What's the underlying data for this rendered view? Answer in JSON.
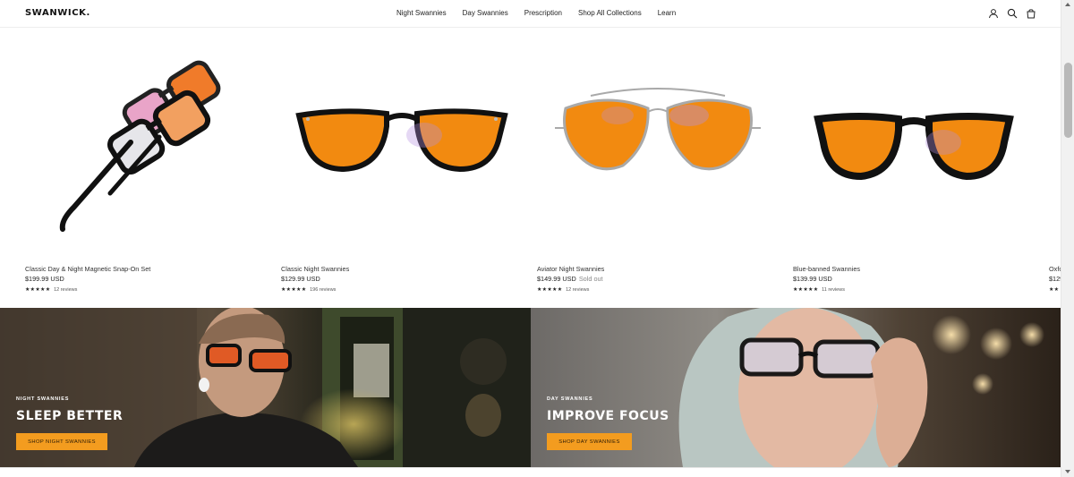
{
  "header": {
    "logo": "SWANWICK.",
    "nav": [
      "Night Swannies",
      "Day Swannies",
      "Prescription",
      "Shop All Collections",
      "Learn"
    ],
    "icons": [
      "account-icon",
      "search-icon",
      "cart-icon"
    ]
  },
  "products": [
    {
      "title": "Classic Day & Night Magnetic Snap-On Set",
      "price": "$199.99 USD",
      "status": "",
      "stars": "★★★★★",
      "reviews": "12 reviews"
    },
    {
      "title": "Classic Night Swannies",
      "price": "$129.99 USD",
      "status": "",
      "stars": "★★★★★",
      "reviews": "196 reviews"
    },
    {
      "title": "Aviator Night Swannies",
      "price": "$149.99 USD",
      "status": "Sold out",
      "stars": "★★★★★",
      "reviews": "12 reviews"
    },
    {
      "title": "Blue-banned Swannies",
      "price": "$139.99 USD",
      "status": "",
      "stars": "★★★★★",
      "reviews": "11 reviews"
    },
    {
      "title": "Oxfo",
      "price": "$129",
      "status": "",
      "stars": "★★",
      "reviews": ""
    }
  ],
  "banners": [
    {
      "kicker": "NIGHT SWANNIES",
      "title": "SLEEP BETTER",
      "button": "SHOP NIGHT SWANNIES"
    },
    {
      "kicker": "DAY SWANNIES",
      "title": "IMPROVE FOCUS",
      "button": "SHOP DAY SWANNIES"
    }
  ],
  "colors": {
    "accent": "#f39c1f",
    "lens_orange": "#f28a10",
    "frame_black": "#111111"
  }
}
